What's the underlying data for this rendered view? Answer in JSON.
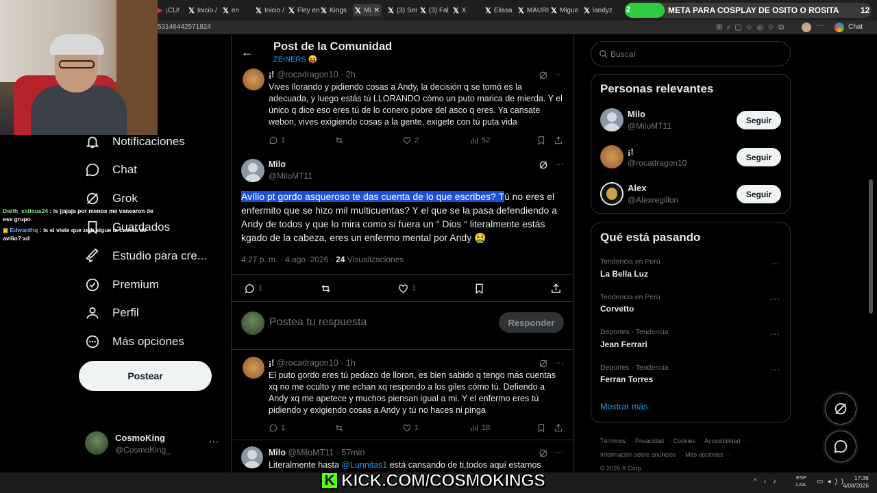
{
  "browser": {
    "tabs": [
      "¡CU!",
      "Inicio /",
      "en",
      "Inicio /",
      "Fley en",
      "Kings",
      "Mi",
      "(3) Ser",
      "(3) Fal",
      "X",
      "Elissa",
      "MAURI",
      "Migue",
      "landyz"
    ],
    "url": "53146442571824",
    "chat_label": "Chat"
  },
  "goal": {
    "current": "2",
    "text": "META PARA COSPLAY DE OSITO O ROSITA",
    "count": "12"
  },
  "stream_chat": [
    {
      "user": "Darth_sidious24",
      "message": "ls jjajaja por menos me vanearon de ese grupo"
    },
    {
      "user": "Edwardhq",
      "message": "ls si viste que zeih sigue la cuenta de avilio? xd"
    }
  ],
  "nav": {
    "items": [
      {
        "label": "Notificaciones",
        "icon": "bell-icon"
      },
      {
        "label": "Chat",
        "icon": "chat-icon"
      },
      {
        "label": "Grok",
        "icon": "grok-icon"
      },
      {
        "label": "Guardados",
        "icon": "bookmark-icon"
      },
      {
        "label": "Estudio para cre...",
        "icon": "rocket-icon"
      },
      {
        "label": "Premium",
        "icon": "verified-icon"
      },
      {
        "label": "Perfil",
        "icon": "person-icon"
      },
      {
        "label": "Más opciones",
        "icon": "more-circle-icon"
      }
    ],
    "post_button": "Postear",
    "profile": {
      "name": "CosmoKing",
      "handle": "@CosmoKing_"
    }
  },
  "header": {
    "title": "Post de la Comunidad",
    "community": "ZEINERS 😝"
  },
  "tweets": {
    "t1": {
      "name": "¡!",
      "handle": "@rocadragon10",
      "time": "· 2h",
      "text": "Vives llorando y pidiendo cosas a Andy, la decisión q se tomó es la adecuada, y luego estás tú LLORANDO cómo un puto marica de mierda. Y el único q dice eso eres tú de lo conero pobre del asco q eres. Ya cansate webon, vives exigiendo cosas a la gente, exigete con tú puta vida",
      "replies": "1",
      "likes": "2",
      "views": "52"
    },
    "main": {
      "name": "Milo",
      "handle": "@MiloMT11",
      "text_highlight": "Avílio pt gordo asqueroso te das cuenta de lo que escribes? T",
      "text_rest": "ú no eres el enfermito que se hizo mil multicuentas? Y el que se la pasa defendiendo a Andy de todos y que lo mira como si fuera un “ Dios “ literalmente estás kgado de la cabeza, eres un enfermo mental por Andy 🤮",
      "timestamp": "4:27 p. m. · 4 ago. 2026 ·",
      "views_count": "24",
      "views_label": "Visualizaciones",
      "replies": "1",
      "likes": "1"
    },
    "reply_box": {
      "placeholder": "Postea tu respuesta",
      "button": "Responder"
    },
    "t3": {
      "name": "¡!",
      "handle": "@rocadragon10",
      "time": "· 1h",
      "text": "El puto gordo eres tú pedazo de lloron, es bien sabido q tengo más cuentas xq no me oculto y me echan xq respondo a los giles cómo tú. Defiendo a Andy xq me apetece y muchos piensan igual a mi. Y el enfermo eres tú pidiendo y exigiendo cosas a Andy y tú no haces ni pinga",
      "replies": "1",
      "likes": "1",
      "views": "18"
    },
    "t4": {
      "name": "Milo",
      "handle": "@MiloMT11",
      "time": "· 57min",
      "text_start": "Literalmente hasta ",
      "mention": "@Lunnitas1",
      "text_end": " está cansando de ti,todos aquí estamos"
    }
  },
  "sidebar": {
    "search_placeholder": "Buscar",
    "relevant": {
      "title": "Personas relevantes",
      "people": [
        {
          "name": "Milo",
          "handle": "@MiloMT11",
          "button": "Seguir"
        },
        {
          "name": "¡!",
          "handle": "@rocadragon10",
          "button": "Seguir"
        },
        {
          "name": "Alex",
          "handle": "@Alexregillon",
          "button": "Seguir"
        }
      ]
    },
    "trends": {
      "title": "Qué está pasando",
      "items": [
        {
          "category": "Tendencia en Perú",
          "name": "La Bella Luz"
        },
        {
          "category": "Tendencia en Perú",
          "name": "Corvetto"
        },
        {
          "category": "Deportes · Tendencia",
          "name": "Jean Ferrari"
        },
        {
          "category": "Deportes · Tendencia",
          "name": "Ferran Torres"
        }
      ],
      "show_more": "Mostrar más"
    },
    "footer": [
      "Términos",
      "Privacidad",
      "Cookies",
      "Accesibilidad",
      "Información sobre anuncios",
      "Más opciones ···",
      "© 2026 X Corp."
    ]
  },
  "overlay": {
    "kick": "KICK.COM/COSMOKINGS"
  },
  "taskbar": {
    "lang1": "ESP",
    "lang2": "LAA",
    "time": "17:36",
    "date": "4/08/2026"
  }
}
